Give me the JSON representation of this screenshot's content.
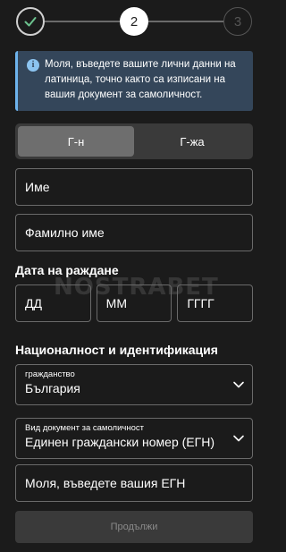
{
  "stepper": {
    "steps": [
      {
        "state": "done",
        "label": ""
      },
      {
        "state": "active",
        "label": "2"
      },
      {
        "state": "todo",
        "label": "3"
      }
    ]
  },
  "info": {
    "icon": "info-icon",
    "text": "Моля, въведете вашите лични данни на латиница, точно както са изписани на вашия документ за самоличност."
  },
  "gender": {
    "options": [
      "Г-н",
      "Г-жа"
    ],
    "selected": "Г-н"
  },
  "fields": {
    "first_name_placeholder": "Име",
    "last_name_placeholder": "Фамилно име"
  },
  "birth_date": {
    "title": "Дата на раждане",
    "day_placeholder": "ДД",
    "month_placeholder": "ММ",
    "year_placeholder": "ГГГГ"
  },
  "identification": {
    "title": "Националност и идентификация",
    "citizenship_label": "гражданство",
    "citizenship_value": "България",
    "doc_type_label": "Вид документ за самоличност",
    "doc_type_value": "Единен граждански номер (ЕГН)",
    "egn_placeholder": "Моля, въведете вашия ЕГН"
  },
  "continue_label": "Продължи",
  "watermark": "NOSTRABET",
  "colors": {
    "background": "#1b1b1b",
    "info_bg": "#34465a",
    "info_accent": "#6db2eb",
    "toggle_active": "#6e6e6e"
  }
}
